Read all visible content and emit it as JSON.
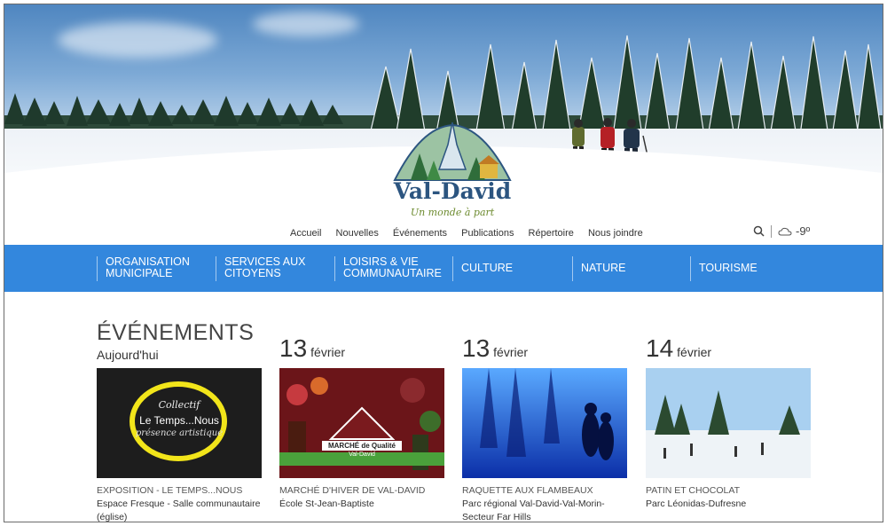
{
  "logo": {
    "name": "Val-David",
    "tagline": "Un monde à part"
  },
  "top_nav": [
    "Accueil",
    "Nouvelles",
    "Événements",
    "Publications",
    "Répertoire",
    "Nous joindre"
  ],
  "weather": {
    "temp": "-9º"
  },
  "main_nav": [
    "ORGANISATION MUNICIPALE",
    "SERVICES AUX CITOYENS",
    "LOISIRS & VIE COMMUNAUTAIRE",
    "CULTURE",
    "NATURE",
    "TOURISME"
  ],
  "events": {
    "title": "ÉVÉNEMENTS",
    "subtitle": "Aujourd'hui",
    "dates": [
      {
        "day": "13",
        "month": "février"
      },
      {
        "day": "13",
        "month": "février"
      },
      {
        "day": "14",
        "month": "février"
      }
    ],
    "items": [
      {
        "title": "EXPOSITION - LE TEMPS...NOUS",
        "place": "Espace Fresque - Salle communautaire (église)",
        "img_text": {
          "line1": "Collectif",
          "line2": "Le Temps...Nous",
          "line3": "présence artistique"
        }
      },
      {
        "title": "MARCHÉ D'HIVER DE VAL-DAVID",
        "place": "École St-Jean-Baptiste",
        "img_text": {
          "line1": "MARCHÉ de Qualité",
          "line2": "Val-David"
        }
      },
      {
        "title": "RAQUETTE AUX FLAMBEAUX",
        "place": "Parc régional Val-David-Val-Morin-Secteur Far Hills"
      },
      {
        "title": "PATIN ET CHOCOLAT",
        "place": "Parc Léonidas-Dufresne"
      }
    ]
  },
  "colors": {
    "nav_bg": "#3387dd",
    "logo_blue": "#2c5580",
    "logo_green": "#6c8a2e"
  }
}
